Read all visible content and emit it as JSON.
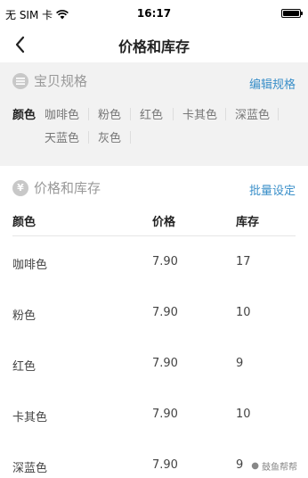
{
  "status_bar": {
    "carrier": "无 SIM 卡",
    "time": "16:17"
  },
  "nav": {
    "title": "价格和库存"
  },
  "spec_section": {
    "title": "宝贝规格",
    "action": "编辑规格",
    "label": "颜色",
    "options": [
      "咖啡色",
      "粉色",
      "红色",
      "卡其色",
      "深蓝色",
      "天蓝色",
      "灰色"
    ]
  },
  "price_section": {
    "title": "价格和库存",
    "action": "批量设定",
    "columns": [
      "颜色",
      "价格",
      "库存"
    ],
    "rows": [
      {
        "color": "咖啡色",
        "price": "7.90",
        "stock": "17"
      },
      {
        "color": "粉色",
        "price": "7.90",
        "stock": "10"
      },
      {
        "color": "红色",
        "price": "7.90",
        "stock": "9"
      },
      {
        "color": "卡其色",
        "price": "7.90",
        "stock": "10"
      },
      {
        "color": "深蓝色",
        "price": "7.90",
        "stock": "9"
      }
    ]
  },
  "watermark": "鼓鱼帮帮"
}
